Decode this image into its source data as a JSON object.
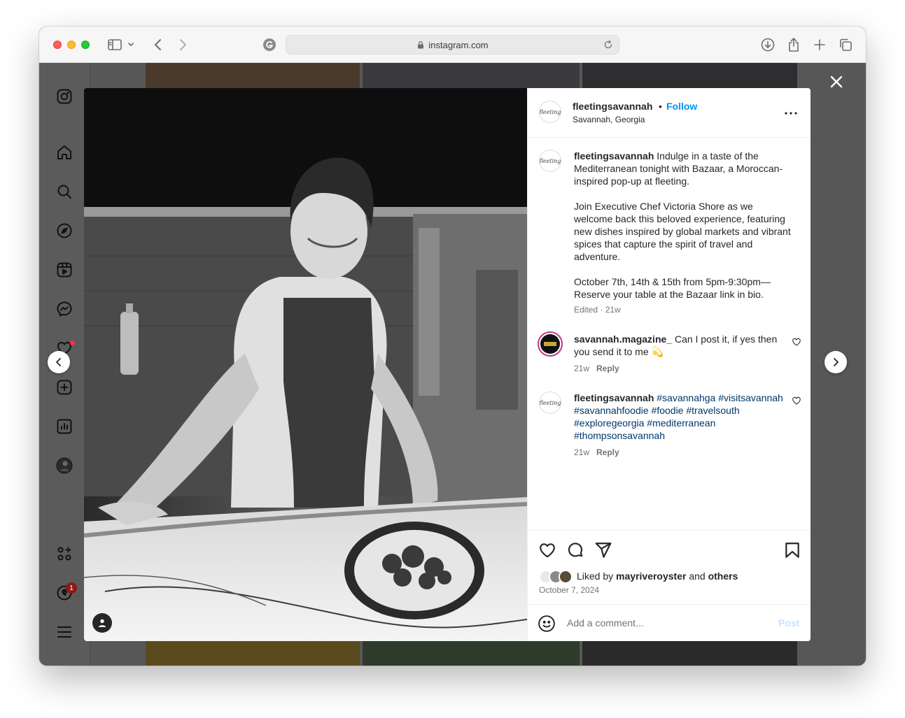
{
  "browser": {
    "url": "instagram.com"
  },
  "post": {
    "username": "fleetingsavannah",
    "separator": "•",
    "follow_label": "Follow",
    "location": "Savannah, Georgia",
    "avatar_signature": "fleeting"
  },
  "caption": {
    "username": "fleetingsavannah",
    "text": "Indulge in a taste of the Mediterranean tonight with Bazaar, a Moroccan-inspired pop-up at fleeting.\n\nJoin Executive Chef Victoria Shore as we welcome back this beloved experience, featuring new dishes inspired by global markets and vibrant spices that capture the spirit of travel and adventure.\n\nOctober 7th, 14th & 15th from 5pm-9:30pm—Reserve your table at the Bazaar link in bio.",
    "meta": "Edited · 21w"
  },
  "comments": [
    {
      "username": "savannah.magazine_",
      "text": "Can I post it, if yes then you send it to me 💫",
      "time": "21w",
      "reply_label": "Reply"
    },
    {
      "username": "fleetingsavannah",
      "hashtags": "#savannahga #visitsavannah #savannahfoodie #foodie #travelsouth #exploregeorgia #mediterranean #thompsonsavannah",
      "time": "21w",
      "reply_label": "Reply"
    }
  ],
  "likes": {
    "prefix": "Liked by",
    "user": "mayriveroyster",
    "joiner": "and",
    "others": "others",
    "date": "October 7, 2024"
  },
  "add_comment": {
    "placeholder": "Add a comment...",
    "post_label": "Post"
  },
  "sidebar": {
    "notification_badge": "1"
  },
  "colors": {
    "accent": "#0095f6",
    "hashtag": "#00376b",
    "notification": "#ff3040"
  }
}
